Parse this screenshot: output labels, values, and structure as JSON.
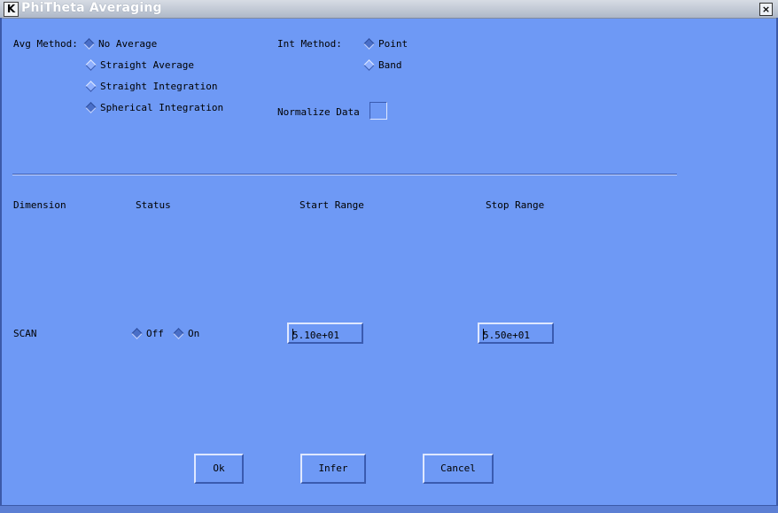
{
  "window": {
    "title": "PhiTheta Averaging",
    "icon_letter": "K",
    "close_glyph": "×"
  },
  "avg_method": {
    "label": "Avg Method:",
    "options": [
      {
        "label": "No Average",
        "selected": true
      },
      {
        "label": "Straight Average",
        "selected": false
      },
      {
        "label": "Straight Integration",
        "selected": false
      },
      {
        "label": "Spherical Integration",
        "selected": true
      }
    ]
  },
  "int_method": {
    "label": "Int Method:",
    "options": [
      {
        "label": "Point",
        "selected": true
      },
      {
        "label": "Band",
        "selected": false
      }
    ]
  },
  "normalize": {
    "label": "Normalize Data",
    "checked": false
  },
  "table": {
    "headers": {
      "dimension": "Dimension",
      "status": "Status",
      "start": "Start Range",
      "stop": "Stop Range"
    },
    "rows": [
      {
        "dimension": "SCAN",
        "status_off": "Off",
        "status_on": "On",
        "start_value": "5.10e+01",
        "stop_value": "5.50e+01"
      }
    ]
  },
  "buttons": {
    "ok": "Ok",
    "infer": "Infer",
    "cancel": "Cancel"
  }
}
